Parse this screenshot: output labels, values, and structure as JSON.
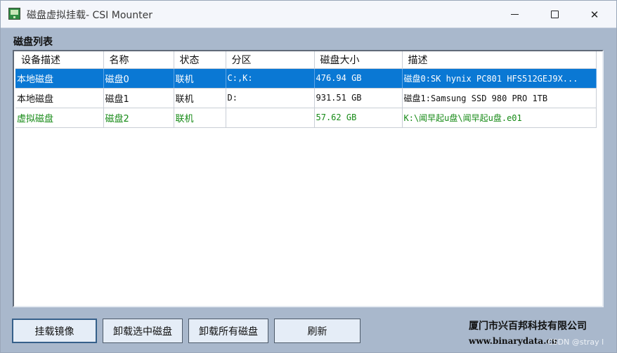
{
  "window": {
    "title": "磁盘虚拟挂载- CSI Mounter",
    "controls": {
      "minimize": "minimize-icon",
      "maximize": "maximize-icon",
      "close": "close-icon"
    }
  },
  "section": {
    "title": "磁盘列表"
  },
  "table": {
    "columns": [
      "设备描述",
      "名称",
      "状态",
      "分区",
      "磁盘大小",
      "描述"
    ],
    "rows": [
      {
        "device": "本地磁盘",
        "name": "磁盘0",
        "status": "联机",
        "partition": "C:,K:",
        "size": "476.94 GB",
        "desc": "磁盘0:SK hynix PC801 HFS512GEJ9X..."
      },
      {
        "device": "本地磁盘",
        "name": "磁盘1",
        "status": "联机",
        "partition": "D:",
        "size": "931.51 GB",
        "desc": "磁盘1:Samsung SSD 980 PRO 1TB"
      },
      {
        "device": "虚拟磁盘",
        "name": "磁盘2",
        "status": "联机",
        "partition": "",
        "size": "57.62 GB",
        "desc": "K:\\闻早起u盘\\闻早起u盘.e01"
      }
    ]
  },
  "buttons": {
    "mount": "挂载镜像",
    "unmount_selected": "卸载选中磁盘",
    "unmount_all": "卸载所有磁盘",
    "refresh": "刷新"
  },
  "footer": {
    "company": "厦门市兴百邦科技有限公司",
    "website": "www.binarydata.cn",
    "watermark": "CSDN @stray l"
  },
  "colors": {
    "selected_row": "#0a78d4",
    "virtual_text": "#168a16",
    "window_bg": "#a9b8cc"
  }
}
